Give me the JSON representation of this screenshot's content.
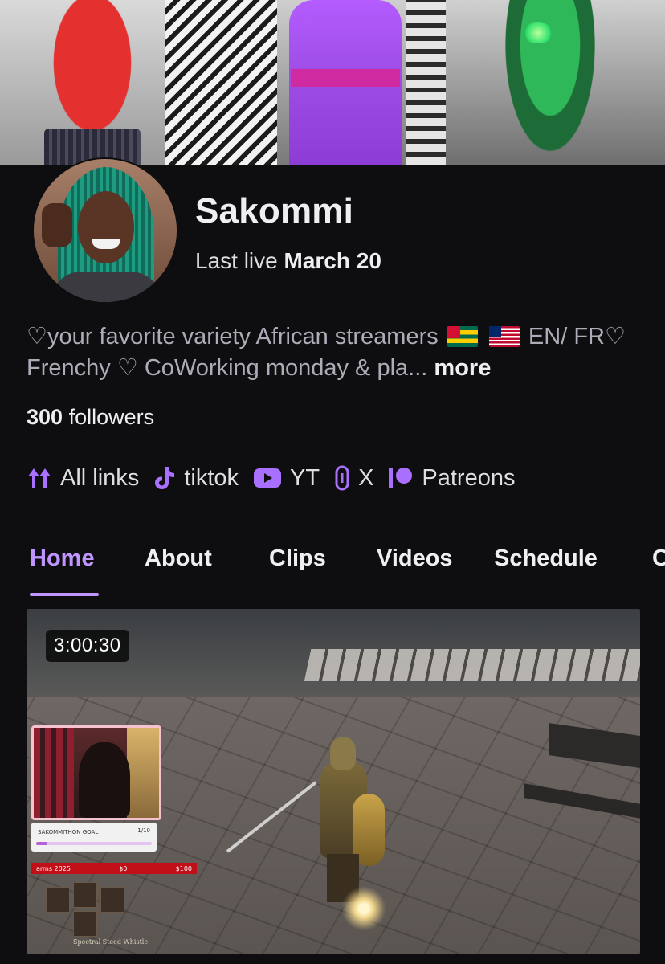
{
  "profile": {
    "channel_name": "Sakommi",
    "last_live_label": "Last live",
    "last_live_date": "March 20",
    "bio_part1": "♡your favorite variety African streamers",
    "bio_part2": "EN/ FR♡ Frenchy ♡ CoWorking monday & pla...",
    "bio_more": "more",
    "followers_count": "300",
    "followers_label": "followers"
  },
  "links": [
    {
      "label": "All links",
      "icon": "all-links-icon"
    },
    {
      "label": "tiktok",
      "icon": "tiktok-icon"
    },
    {
      "label": "YT",
      "icon": "youtube-icon"
    },
    {
      "label": "X",
      "icon": "link-icon"
    },
    {
      "label": "Patreons",
      "icon": "patreon-icon"
    }
  ],
  "tabs": [
    {
      "label": "Home",
      "active": true
    },
    {
      "label": "About",
      "active": false
    },
    {
      "label": "Clips",
      "active": false
    },
    {
      "label": "Videos",
      "active": false
    },
    {
      "label": "Schedule",
      "active": false
    },
    {
      "label": "C",
      "active": false
    }
  ],
  "video": {
    "duration": "3:00:30",
    "overlay": {
      "goal_title": "SAKOMMITHON GOAL",
      "goal_count": "1/10",
      "goal_progress": 0.1,
      "donation_name": "arms 2025",
      "donation_current": "$0",
      "donation_target": "$100",
      "item_caption": "Spectral Steed Whistle"
    }
  },
  "colors": {
    "accent": "#bf94ff",
    "link_icon": "#a970ff",
    "background": "#0e0e10"
  }
}
